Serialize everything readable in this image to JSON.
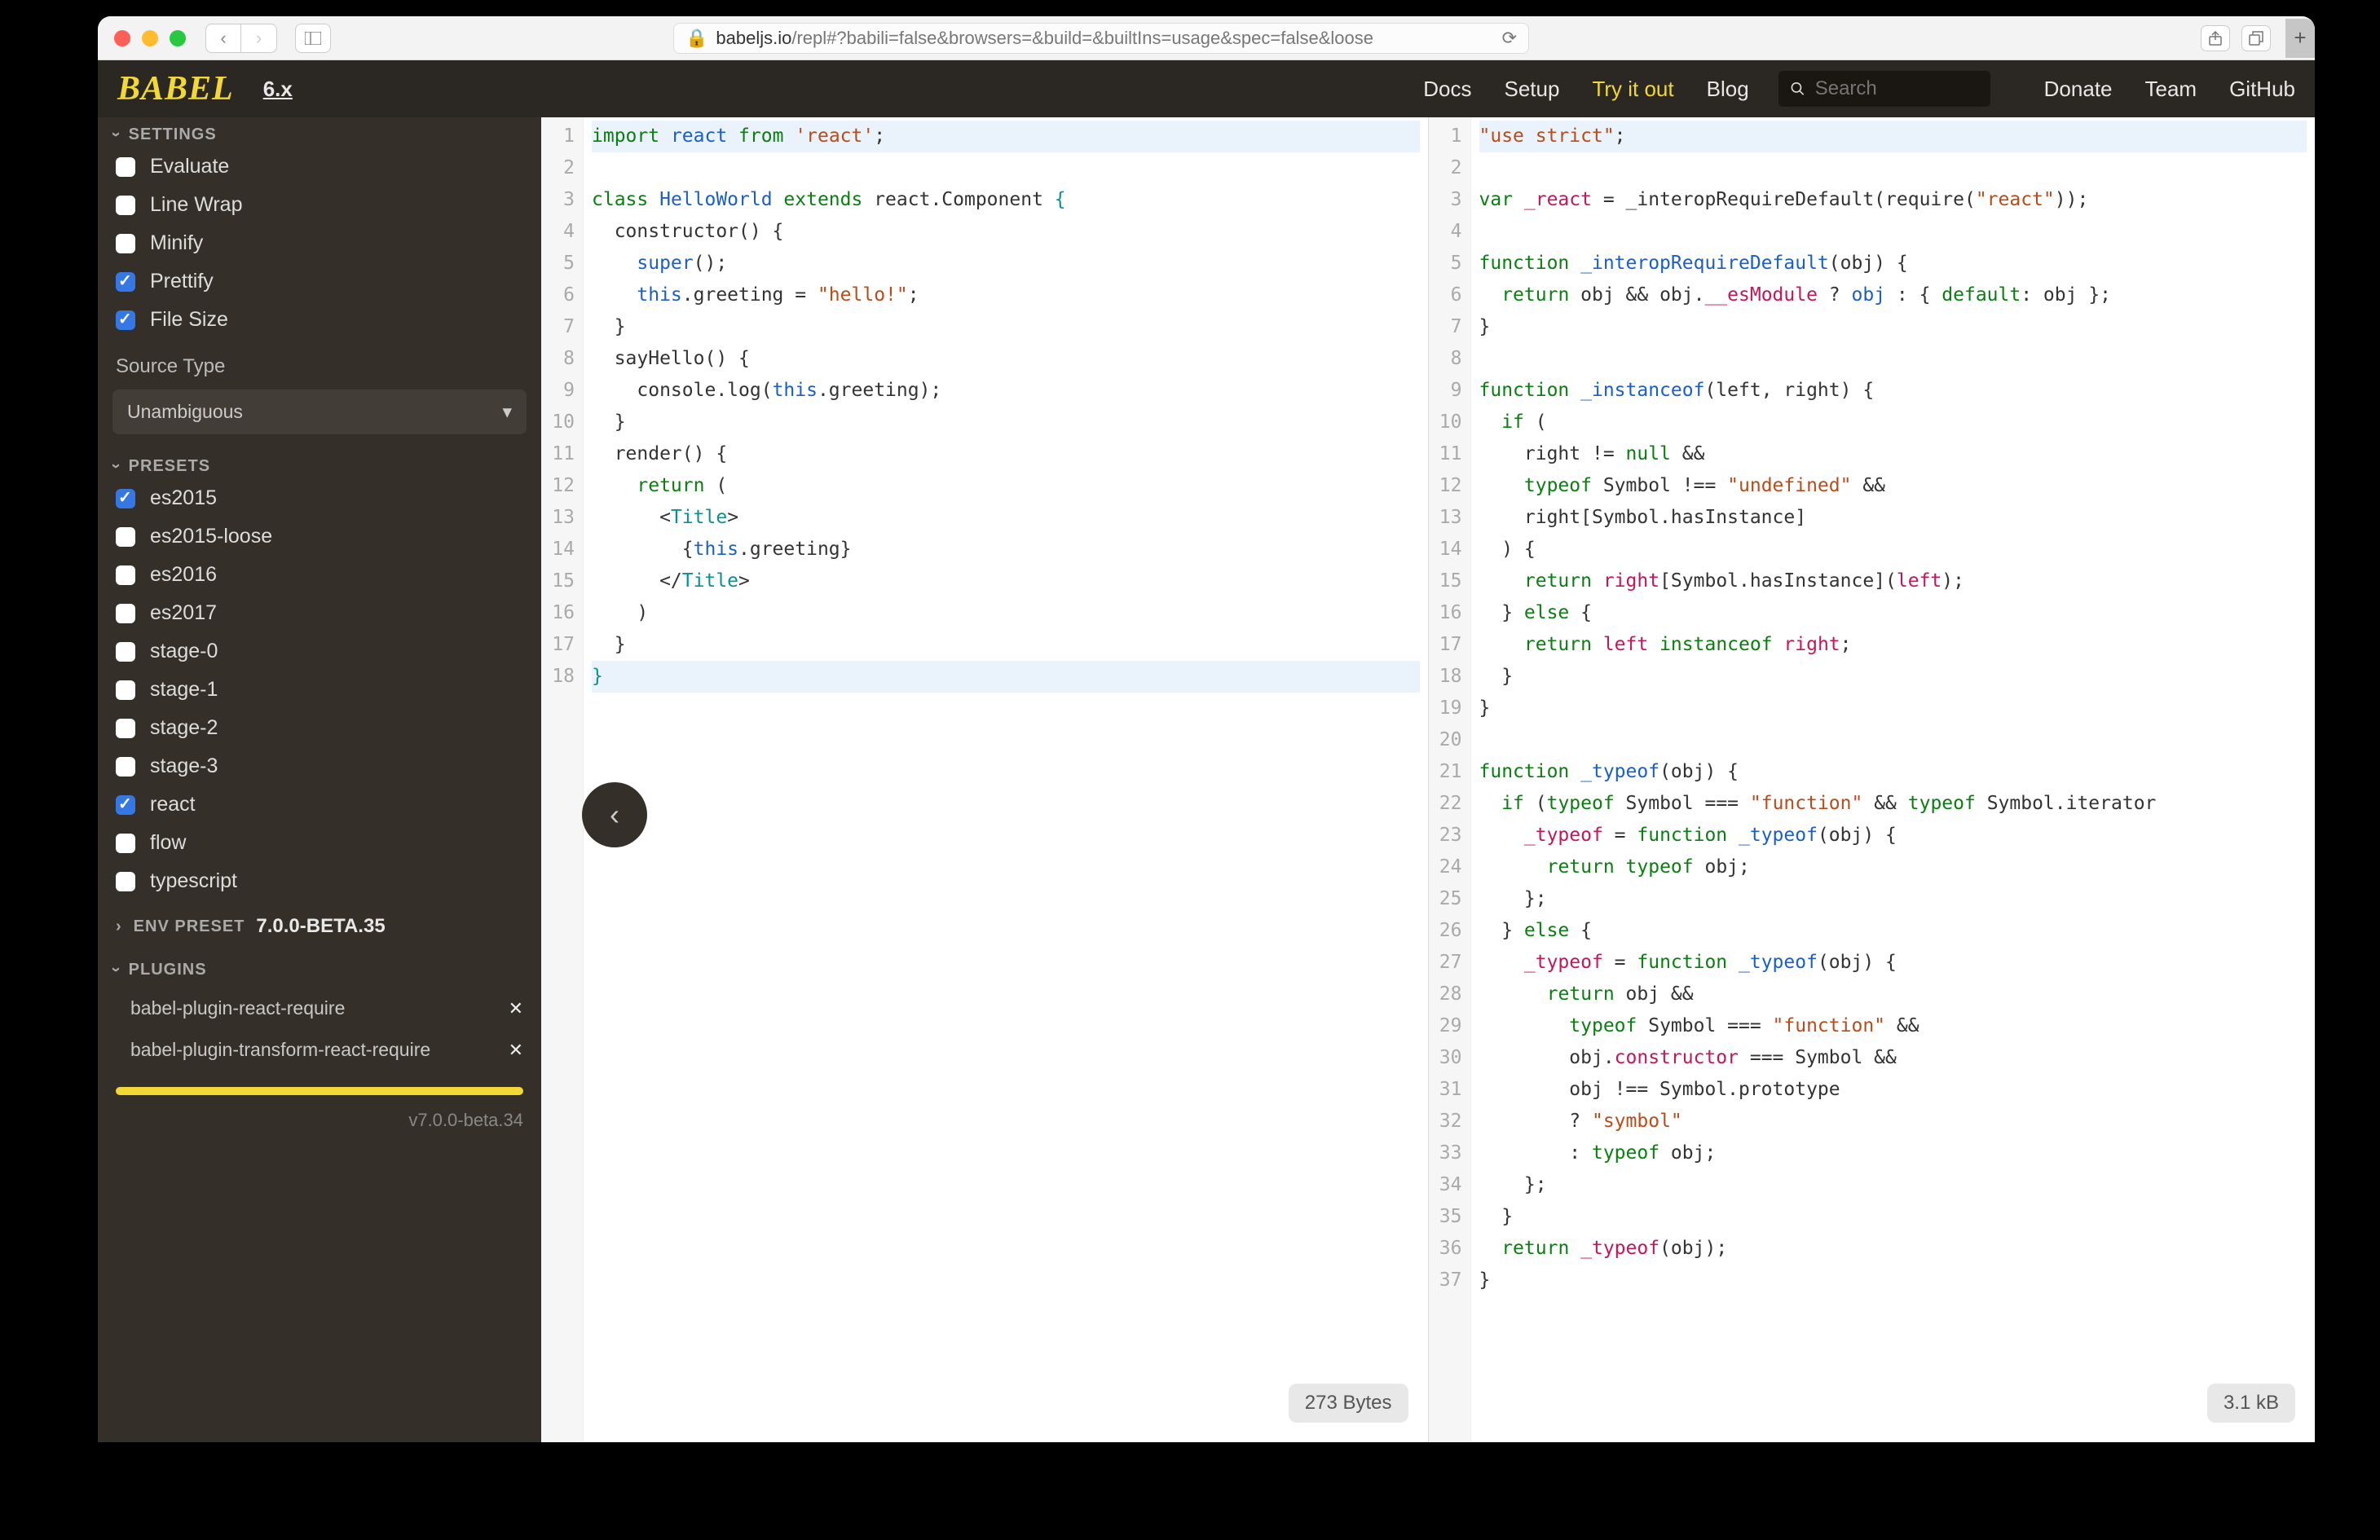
{
  "browser": {
    "url_host": "babeljs.io",
    "url_path": "/repl#?babili=false&browsers=&build=&builtIns=usage&spec=false&loose"
  },
  "nav": {
    "logo": "BABEL",
    "version": "6.x",
    "links": [
      "Docs",
      "Setup",
      "Try it out",
      "Blog"
    ],
    "active_index": 2,
    "search_placeholder": "Search",
    "right_links": [
      "Donate",
      "Team",
      "GitHub"
    ]
  },
  "sidebar": {
    "settings": {
      "title": "SETTINGS",
      "options": [
        {
          "label": "Evaluate",
          "checked": false
        },
        {
          "label": "Line Wrap",
          "checked": false
        },
        {
          "label": "Minify",
          "checked": false
        },
        {
          "label": "Prettify",
          "checked": true
        },
        {
          "label": "File Size",
          "checked": true
        }
      ],
      "source_type_label": "Source Type",
      "source_type_value": "Unambiguous"
    },
    "presets": {
      "title": "PRESETS",
      "options": [
        {
          "label": "es2015",
          "checked": true
        },
        {
          "label": "es2015-loose",
          "checked": false
        },
        {
          "label": "es2016",
          "checked": false
        },
        {
          "label": "es2017",
          "checked": false
        },
        {
          "label": "stage-0",
          "checked": false
        },
        {
          "label": "stage-1",
          "checked": false
        },
        {
          "label": "stage-2",
          "checked": false
        },
        {
          "label": "stage-3",
          "checked": false
        },
        {
          "label": "react",
          "checked": true
        },
        {
          "label": "flow",
          "checked": false
        },
        {
          "label": "typescript",
          "checked": false
        }
      ]
    },
    "env_preset": {
      "title": "ENV PRESET",
      "version": "7.0.0-BETA.35"
    },
    "plugins": {
      "title": "PLUGINS",
      "items": [
        {
          "label": "babel-plugin-react-require"
        },
        {
          "label": "babel-plugin-transform-react-require"
        }
      ]
    },
    "version_info": "v7.0.0-beta.34"
  },
  "input_editor": {
    "size_label": "273 Bytes",
    "lines": [
      [
        {
          "t": "import ",
          "c": "k"
        },
        {
          "t": "react ",
          "c": "n"
        },
        {
          "t": "from ",
          "c": "k"
        },
        {
          "t": "'react'",
          "c": "s"
        },
        {
          "t": ";",
          "c": "o"
        }
      ],
      [],
      [
        {
          "t": "class ",
          "c": "k"
        },
        {
          "t": "HelloWorld ",
          "c": "n"
        },
        {
          "t": "extends ",
          "c": "k"
        },
        {
          "t": "react.Component ",
          "c": "v"
        },
        {
          "t": "{",
          "c": "t"
        }
      ],
      [
        {
          "t": "  constructor",
          "c": "v"
        },
        {
          "t": "() {",
          "c": "o"
        }
      ],
      [
        {
          "t": "    ",
          "c": "o"
        },
        {
          "t": "super",
          "c": "n"
        },
        {
          "t": "();",
          "c": "o"
        }
      ],
      [
        {
          "t": "    ",
          "c": "o"
        },
        {
          "t": "this",
          "c": "n"
        },
        {
          "t": ".greeting = ",
          "c": "o"
        },
        {
          "t": "\"hello!\"",
          "c": "s"
        },
        {
          "t": ";",
          "c": "o"
        }
      ],
      [
        {
          "t": "  }",
          "c": "o"
        }
      ],
      [
        {
          "t": "  sayHello",
          "c": "v"
        },
        {
          "t": "() {",
          "c": "o"
        }
      ],
      [
        {
          "t": "    console.log(",
          "c": "o"
        },
        {
          "t": "this",
          "c": "n"
        },
        {
          "t": ".greeting);",
          "c": "o"
        }
      ],
      [
        {
          "t": "  }",
          "c": "o"
        }
      ],
      [
        {
          "t": "  render",
          "c": "v"
        },
        {
          "t": "() {",
          "c": "o"
        }
      ],
      [
        {
          "t": "    ",
          "c": "o"
        },
        {
          "t": "return",
          "c": "k"
        },
        {
          "t": " (",
          "c": "o"
        }
      ],
      [
        {
          "t": "      <",
          "c": "o"
        },
        {
          "t": "Title",
          "c": "t"
        },
        {
          "t": ">",
          "c": "o"
        }
      ],
      [
        {
          "t": "        {",
          "c": "o"
        },
        {
          "t": "this",
          "c": "n"
        },
        {
          "t": ".greeting}",
          "c": "o"
        }
      ],
      [
        {
          "t": "      </",
          "c": "o"
        },
        {
          "t": "Title",
          "c": "t"
        },
        {
          "t": ">",
          "c": "o"
        }
      ],
      [
        {
          "t": "    )",
          "c": "o"
        }
      ],
      [
        {
          "t": "  }",
          "c": "o"
        }
      ],
      [
        {
          "t": "}",
          "c": "t"
        }
      ]
    ],
    "highlight_lines": [
      0,
      17
    ]
  },
  "output_editor": {
    "size_label": "3.1 kB",
    "lines": [
      [
        {
          "t": "\"use strict\"",
          "c": "s"
        },
        {
          "t": ";",
          "c": "o"
        }
      ],
      [],
      [
        {
          "t": "var ",
          "c": "k"
        },
        {
          "t": "_react",
          "c": "r"
        },
        {
          "t": " = ",
          "c": "o"
        },
        {
          "t": "_interopRequireDefault",
          "c": "v"
        },
        {
          "t": "(",
          "c": "o"
        },
        {
          "t": "require",
          "c": "v"
        },
        {
          "t": "(",
          "c": "o"
        },
        {
          "t": "\"react\"",
          "c": "s"
        },
        {
          "t": "));",
          "c": "o"
        }
      ],
      [],
      [
        {
          "t": "function ",
          "c": "k"
        },
        {
          "t": "_interopRequireDefault",
          "c": "f"
        },
        {
          "t": "(obj) {",
          "c": "o"
        }
      ],
      [
        {
          "t": "  ",
          "c": "o"
        },
        {
          "t": "return ",
          "c": "k"
        },
        {
          "t": "obj && obj.",
          "c": "o"
        },
        {
          "t": "__esModule",
          "c": "r"
        },
        {
          "t": " ? ",
          "c": "o"
        },
        {
          "t": "obj",
          "c": "n"
        },
        {
          "t": " : { ",
          "c": "o"
        },
        {
          "t": "default",
          "c": "k"
        },
        {
          "t": ": obj };",
          "c": "o"
        }
      ],
      [
        {
          "t": "}",
          "c": "o"
        }
      ],
      [],
      [
        {
          "t": "function ",
          "c": "k"
        },
        {
          "t": "_instanceof",
          "c": "f"
        },
        {
          "t": "(left, right) {",
          "c": "o"
        }
      ],
      [
        {
          "t": "  ",
          "c": "o"
        },
        {
          "t": "if ",
          "c": "k"
        },
        {
          "t": "(",
          "c": "o"
        }
      ],
      [
        {
          "t": "    right != ",
          "c": "o"
        },
        {
          "t": "null ",
          "c": "k"
        },
        {
          "t": "&&",
          "c": "o"
        }
      ],
      [
        {
          "t": "    ",
          "c": "o"
        },
        {
          "t": "typeof ",
          "c": "k"
        },
        {
          "t": "Symbol !== ",
          "c": "o"
        },
        {
          "t": "\"undefined\"",
          "c": "s"
        },
        {
          "t": " &&",
          "c": "o"
        }
      ],
      [
        {
          "t": "    right[Symbol.hasInstance]",
          "c": "o"
        }
      ],
      [
        {
          "t": "  ) {",
          "c": "o"
        }
      ],
      [
        {
          "t": "    ",
          "c": "o"
        },
        {
          "t": "return ",
          "c": "k"
        },
        {
          "t": "right",
          "c": "r"
        },
        {
          "t": "[Symbol.hasInstance](",
          "c": "o"
        },
        {
          "t": "left",
          "c": "r"
        },
        {
          "t": ");",
          "c": "o"
        }
      ],
      [
        {
          "t": "  } ",
          "c": "o"
        },
        {
          "t": "else ",
          "c": "k"
        },
        {
          "t": "{",
          "c": "o"
        }
      ],
      [
        {
          "t": "    ",
          "c": "o"
        },
        {
          "t": "return ",
          "c": "k"
        },
        {
          "t": "left",
          "c": "r"
        },
        {
          "t": " ",
          "c": "o"
        },
        {
          "t": "instanceof ",
          "c": "k"
        },
        {
          "t": "right",
          "c": "r"
        },
        {
          "t": ";",
          "c": "o"
        }
      ],
      [
        {
          "t": "  }",
          "c": "o"
        }
      ],
      [
        {
          "t": "}",
          "c": "o"
        }
      ],
      [],
      [
        {
          "t": "function ",
          "c": "k"
        },
        {
          "t": "_typeof",
          "c": "f"
        },
        {
          "t": "(obj) {",
          "c": "o"
        }
      ],
      [
        {
          "t": "  ",
          "c": "o"
        },
        {
          "t": "if ",
          "c": "k"
        },
        {
          "t": "(",
          "c": "o"
        },
        {
          "t": "typeof ",
          "c": "k"
        },
        {
          "t": "Symbol === ",
          "c": "o"
        },
        {
          "t": "\"function\"",
          "c": "s"
        },
        {
          "t": " && ",
          "c": "o"
        },
        {
          "t": "typeof ",
          "c": "k"
        },
        {
          "t": "Symbol.iterator",
          "c": "o"
        }
      ],
      [
        {
          "t": "    ",
          "c": "o"
        },
        {
          "t": "_typeof",
          "c": "r"
        },
        {
          "t": " = ",
          "c": "o"
        },
        {
          "t": "function ",
          "c": "k"
        },
        {
          "t": "_typeof",
          "c": "f"
        },
        {
          "t": "(obj) {",
          "c": "o"
        }
      ],
      [
        {
          "t": "      ",
          "c": "o"
        },
        {
          "t": "return ",
          "c": "k"
        },
        {
          "t": "typeof ",
          "c": "k"
        },
        {
          "t": "obj;",
          "c": "o"
        }
      ],
      [
        {
          "t": "    };",
          "c": "o"
        }
      ],
      [
        {
          "t": "  } ",
          "c": "o"
        },
        {
          "t": "else ",
          "c": "k"
        },
        {
          "t": "{",
          "c": "o"
        }
      ],
      [
        {
          "t": "    ",
          "c": "o"
        },
        {
          "t": "_typeof",
          "c": "r"
        },
        {
          "t": " = ",
          "c": "o"
        },
        {
          "t": "function ",
          "c": "k"
        },
        {
          "t": "_typeof",
          "c": "f"
        },
        {
          "t": "(obj) {",
          "c": "o"
        }
      ],
      [
        {
          "t": "      ",
          "c": "o"
        },
        {
          "t": "return ",
          "c": "k"
        },
        {
          "t": "obj &&",
          "c": "o"
        }
      ],
      [
        {
          "t": "        ",
          "c": "o"
        },
        {
          "t": "typeof ",
          "c": "k"
        },
        {
          "t": "Symbol === ",
          "c": "o"
        },
        {
          "t": "\"function\"",
          "c": "s"
        },
        {
          "t": " &&",
          "c": "o"
        }
      ],
      [
        {
          "t": "        obj.",
          "c": "o"
        },
        {
          "t": "constructor",
          "c": "r"
        },
        {
          "t": " === Symbol &&",
          "c": "o"
        }
      ],
      [
        {
          "t": "        obj !== Symbol.prototype",
          "c": "o"
        }
      ],
      [
        {
          "t": "        ? ",
          "c": "o"
        },
        {
          "t": "\"symbol\"",
          "c": "s"
        }
      ],
      [
        {
          "t": "        : ",
          "c": "o"
        },
        {
          "t": "typeof ",
          "c": "k"
        },
        {
          "t": "obj;",
          "c": "o"
        }
      ],
      [
        {
          "t": "    };",
          "c": "o"
        }
      ],
      [
        {
          "t": "  }",
          "c": "o"
        }
      ],
      [
        {
          "t": "  ",
          "c": "o"
        },
        {
          "t": "return ",
          "c": "k"
        },
        {
          "t": "_typeof",
          "c": "r"
        },
        {
          "t": "(obj);",
          "c": "o"
        }
      ],
      [
        {
          "t": "}",
          "c": "o"
        }
      ]
    ],
    "highlight_lines": [
      0
    ]
  }
}
